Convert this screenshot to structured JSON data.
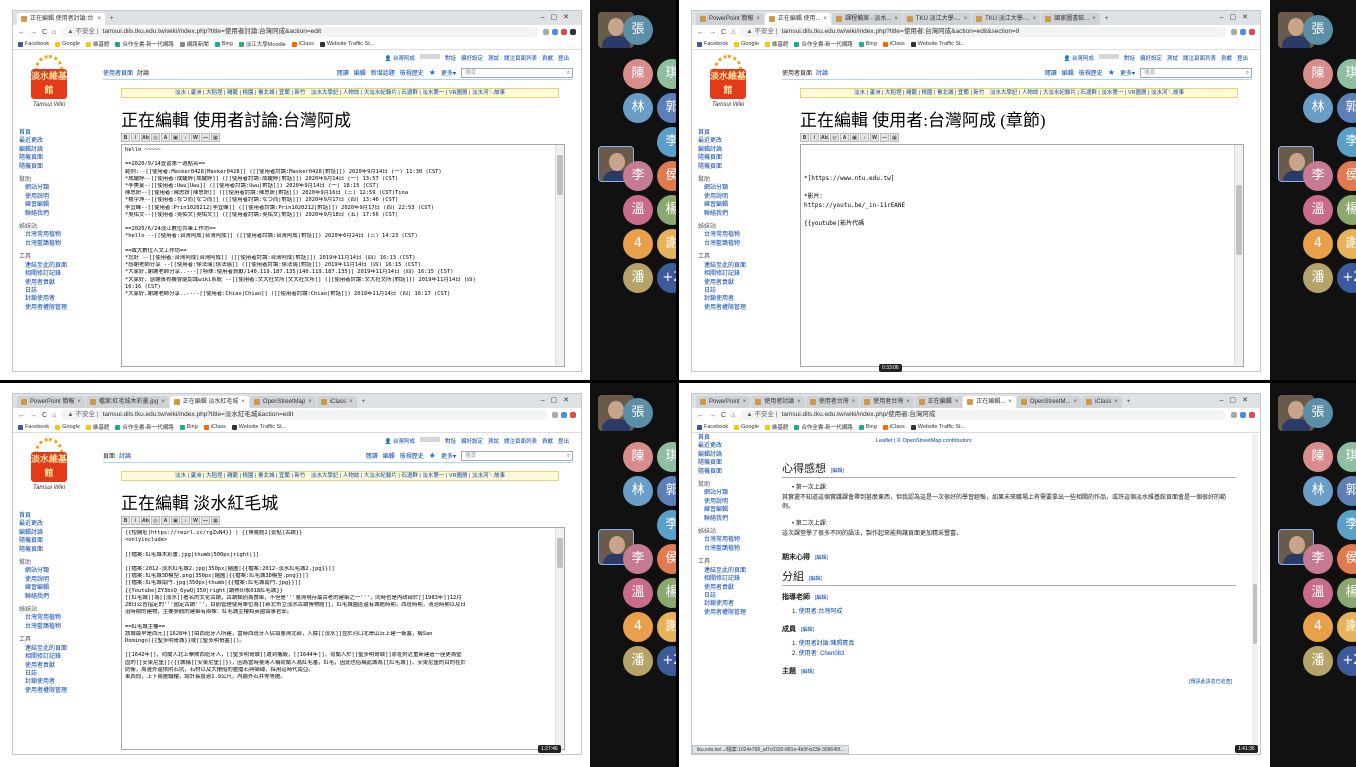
{
  "colors": {
    "rail_bg": "#111111",
    "wiki_link": "#0645ad",
    "logo_red": "#e33a1c"
  },
  "common": {
    "user_links": [
      "台灣阿成",
      "對話",
      "偏好設定",
      "測試",
      "關注頁面列表",
      "貢獻",
      "登出"
    ],
    "sidebar": [
      {
        "head": "",
        "items": [
          "首頁",
          "最近更改",
          "編輯討論",
          "隨機頁面",
          "隨機頁面"
        ]
      },
      {
        "head": "幫助",
        "items": [
          "網站分類",
          "使用說明",
          "練習編輯",
          "聯絡我們"
        ]
      },
      {
        "head": "姊妹站",
        "items": [
          "台灣常用植物",
          "台灣藍鵲植物"
        ]
      },
      {
        "head": "工具",
        "items": [
          "連結至此的頁面",
          "相關修訂記錄",
          "使用者貢獻",
          "日誌",
          "封鎖使用者",
          "使用者權限管理"
        ]
      }
    ],
    "view_tabs": [
      "閱讀",
      "編輯",
      "檢視歷史"
    ],
    "more": "更多",
    "search_placeholder": "搜尋",
    "navbar": "淡水 | 蘆洲 | 大稻埕 | 雞籠 | 桃園 | 臺北城 | 宜蘭 | 新竹　淡水大學記 | 人物誌 | 大淡水紀錄片 | 石滬群 | 淡水第一 | VR圖層 | 淡水河＼故事",
    "logo_name": "Tamsui Wiki",
    "logo_board": "淡水維基館"
  },
  "q1": {
    "tabs": [
      "正在編輯 使用者討論:台灣阿成",
      "+"
    ],
    "url": "tamsui.dils.tku.edu.tw/wiki/index.php?title=使用者討論:台灣阿成&action=edit",
    "page_tabs": [
      "使用者頁面",
      "討論"
    ],
    "extra_tab": "新增話題",
    "title": "正在編輯 使用者討論:台灣阿成",
    "lines": [
      "hello ~~~~~",
      "",
      "==2020/9/14壹習第一週點名==",
      "範例:--[[使用者:Masker0428|Masker0428]] ([[使用者討論:Masker0428|對話]]) 2020年9月14日 (一) 11:30 (CST)",
      "*成婕婷--[[使用者:成婕婷|成婕婷]] ([[使用者討論:成婕婷|對話]]) 2020年9月14日 (一) 13:57 (CST)",
      "*李美宴--[[使用者:Uwu|Uwu]] ([[使用者討論:Uwu|對話]]) 2020年9月14日 (一) 18:15 (CST)",
      "陳思妍--[[使用者:陳思妍|陳思妍]] ([[使用者討論:陳思妍|對話]]) 2020年9月16日 (三) 12:59 (CST)Tina",
      "*楊宇琤--[[使用者:なつ而|なつ而]] ([[使用者討論:なつ而|對話]]) 2020年9月17日 (四) 13:46 (CST)",
      "李宜峰--[[使用者:Prin1020212|李宜峰]] ([[使用者討論:Prin1020212|對話]]) 2020年9月17日 (四) 22:53 (CST)",
      "*吳佑文--[[使用者:吳佑文|吳佑文]] ([[使用者討論:吳佑文|對話]]) 2020年9月18日 (五) 17:56 (CST)",
      "",
      "==2020/6/24淡江數位共筆工作坊==",
      "*hello --[[使用者:台灣阿成|台灣阿成]] ([[使用者討論:台灣阿成|對話]]) 2020年6月24日 (三) 14:23 (CST)",
      "",
      "==致大數位人文工作坊==",
      "*您好 --[[使用者:台灣阿成|台灣阿成]] ([[使用者討論:台灣阿成|對話]]) 2019年11月14日 (四) 16:13 (CST)",
      "*感謝老師分享 --[[使用者:徐法瑞|徐法瑞]] ([[使用者討論:徐法瑞|對話]]) 2019年11月14日 (四) 16:15 (CST)",
      "*大家好,謝謝老師分享..---[[特殊:使用者貢獻/140.119.187.135|140.119.187.135]] 2019年11月14日 (四) 16:15 (CST)",
      "*大家好，感謝黃宥機會能認識wiki系統 --[[使用者:文大社文所|文大社文所]] ([[使用者討論:文大社文所|對話]]) 2019年11月14日 (四)",
      "16:16 (CST)",
      "*大家好,謝謝老師分享..----[[使用者:Chiao|Chiao]] ([[使用者討論:Chiao|對話]]) 2019年11月14日 (四) 16:17 (CST)"
    ],
    "participants": [
      {
        "letter": "張",
        "color": "#5b8fa8"
      },
      {
        "letter": "陳",
        "color": "#d98c8c"
      },
      {
        "letter": "琪",
        "color": "#8fbfa0"
      },
      {
        "letter": "林",
        "color": "#6b9ec7"
      },
      {
        "letter": "郭",
        "color": "#5c7fb8"
      },
      {
        "letter": "李",
        "color": "#5ba0c8"
      },
      {
        "letter": "李",
        "color": "#c77b93"
      },
      {
        "letter": "侯",
        "color": "#e07a4f"
      },
      {
        "letter": "溫",
        "color": "#c96b8a"
      },
      {
        "letter": "楊",
        "color": "#8aa870"
      },
      {
        "letter": "4",
        "color": "#e8a04a"
      },
      {
        "letter": "謝",
        "color": "#e6b35a"
      },
      {
        "letter": "潘",
        "color": "#b5a36a"
      },
      {
        "letter": "+2",
        "color": "#3b5b9a"
      }
    ]
  },
  "q2": {
    "tabs": [
      "PowerPoint 簡報",
      "正在編輯 使用...",
      "課程備案 - 淡水...",
      "TKU 淡江大學-...",
      "TKU 淡江大學-...",
      "國家圖書館...",
      "+"
    ],
    "url": "tamsui.dils.tku.edu.tw/wiki/index.php?title=使用者:台灣阿成&action=edit&section=8",
    "page_tabs": [
      "使用者頁面",
      "討論"
    ],
    "title": "正在編輯 使用者:台灣阿成 (章節)",
    "lines": [
      "",
      "",
      "",
      "*[https://www.ntu.edu.tw]",
      "",
      "*影片：",
      "https://youtu.be/_in-11rEANE",
      "",
      "{{youtube|影片代碼"
    ],
    "time": "0:33:06"
  },
  "q3": {
    "tabs": [
      "PowerPoint 簡報",
      "檔案:紅毛城木彩畫.jpg",
      "正在編輯 淡水紅毛城",
      "OpenStreetMap",
      "iClass",
      "+"
    ],
    "url": "tamsui.dils.tku.edu.tw/wiki/index.php?title=淡水紅毛城&action=edit",
    "page_tabs": [
      "頁面",
      "討論"
    ],
    "title": "正在編輯 淡水紅毛城",
    "lines": [
      "{{短網址|https://reurl.cc/rgZvN4}} | {{博覽館2|景點|古蹟}}",
      "<onlyinclude>",
      "",
      "[[檔案:紅毛城木彩畫.jpg|thumb|500px|right|]]",
      "",
      "[[檔案:2012-淡水紅毛城2.jpg|350px|縮圖|{{檔案:2012-淡水紅毛城2.jpg}}]]",
      "[[檔案:紅毛城3D模型.png|350px|縮圖|{{檔案:紅毛城3D模型.png}}]]",
      "[[檔案:紅毛城南門.jpg|350px|thumb|{{檔案:紅毛城南門.jpg}}]]",
      "{{Youtube|ZY3bxQ_6ywQ|350|right|蹟熱印象018紅毛城}}",
      "    [[紅毛城]]為[[淡水]]著名的文化古蹟，古蹟類別為食庫，不但是'''臺灣現存最古老的建築之一'''，同時也是內政部於[[1983年]]12月",
      "28日公告指定的'''國定古蹟'''，目前管理使用單位為[[新北市立淡水古蹟博物館]]，紅毛城園區還有城館時期，西班時期，清治時期以及日",
      "治時期的建物，主要參觀的建築有兩棟：紅毛城主樓和英國領事官邸。",
      "",
      "==紅毛城主樓==",
      "    該城最早是西元[[1628年]]由西班牙人所建，當時西班牙人佔領臺灣北部，入據[[淡水]]並於河口北岸山丘上建一衛塞，稱San",
      "Domingo({{聖多明哥城}}或[[聖多明哥塞]])。",
      "",
      "    [[1642年]]，荷蘭人北上擊敗西班牙人，[[聖多明哥城]]遭到攜毀，[[1644年]]，荷蘭人於[[聖多明哥城]]原址附近重新建造一座更為堅",
      "固的[[安東尼堡]]({{城稱[[安東尼堡]]})，因為當時臺灣人稱荷蘭人為紅毛番，紅毛，因此也俗稱此城為[[紅毛城]]。安東尼堡的目的在於",
      "防衛，周邊外還依附石坑，石材以及大柵船的壓艙石與築磚，採用這時代南亞。",
      "東西向，上下兩層鐵樓，總計長度逾1.9公尺，內牆外石井等等施。"
    ],
    "time": "1:27:46"
  },
  "q4": {
    "tabs": [
      "PowerPoint",
      "使用者討論",
      "使用者台灣",
      "使用者台灣",
      "正在編輯",
      "正在編輯...",
      "OpenStreetM...",
      "iClass",
      "+"
    ],
    "url": "tamsui.dils.tku.edu.tw/wiki/index.php/使用者:台灣阿成",
    "credit": "Leaflet | © OpenStreetMap contributors",
    "h_reflect": "心得感想",
    "edit": "[編輯]",
    "bullet1": "第一次上課:",
    "para1": "其實還不知道這個實踐課會帶到甚麼東西，但我認為這是一次很好的學習經驗，如果未來職場上有需要拿出一些相關的作品，或許這個淡水維基館頁面會是一個很好的範例。",
    "bullet2": "第二次上課:",
    "para2": "這次課堂學了很多不同的語法，製作起來能夠讓頁面更加精采豐富。",
    "h_final": "期末心得",
    "h_group": "分組",
    "h_teacher": "指導老師",
    "teacher": "使用者:台灣阿成",
    "h_members": "成員",
    "member1": "使用者討論:陳照賓真",
    "member2": "使用者: Chen083",
    "h_topic": "主題",
    "return_link": "[傳訊此訊息已巡查]",
    "status": "tku.edu.tw/.../檔案:1024x768_af7c0330-881e-4b0f-b23b-309645f...",
    "time": "1:41:36"
  }
}
